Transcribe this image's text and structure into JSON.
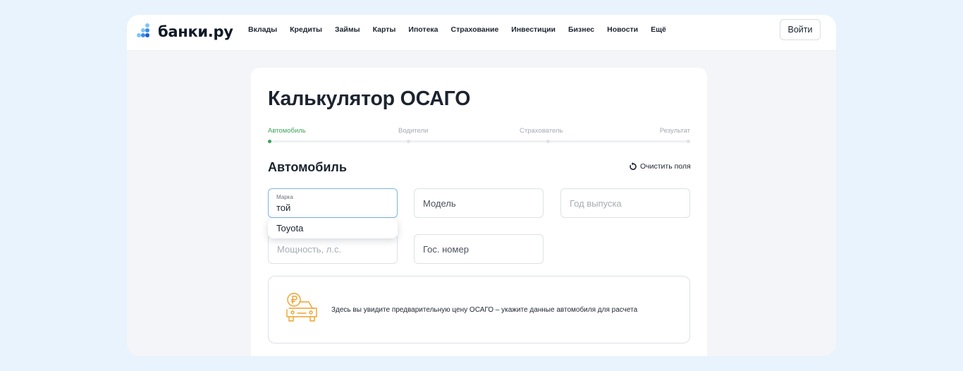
{
  "brand": {
    "name": "банки.ру",
    "dot_colors": [
      "#7ec6f5",
      "#3d8ef0",
      "#1b5fd1"
    ]
  },
  "nav": {
    "items": [
      "Вклады",
      "Кредиты",
      "Займы",
      "Карты",
      "Ипотека",
      "Страхование",
      "Инвестиции",
      "Бизнес",
      "Новости",
      "Ещё"
    ]
  },
  "header": {
    "login_label": "Войти"
  },
  "page": {
    "title": "Калькулятор ОСАГО"
  },
  "steps": {
    "items": [
      "Автомобиль",
      "Водители",
      "Страхователь",
      "Результат"
    ],
    "active_index": 0,
    "active_color": "#3aa657"
  },
  "section": {
    "title": "Автомобиль",
    "clear_label": "Очистить поля",
    "clear_icon": "refresh-icon"
  },
  "form": {
    "brand_field": {
      "label": "Марка",
      "value": "той"
    },
    "model_field": {
      "placeholder": "Модель"
    },
    "year_field": {
      "placeholder": "Год выпуска"
    },
    "power_field": {
      "placeholder": "Мощность, л.с."
    },
    "plate_field": {
      "placeholder": "Гос. номер"
    },
    "suggestions": [
      "Toyota"
    ]
  },
  "info": {
    "icon": "car-ruble-icon",
    "text": "Здесь вы увидите предварительную цену ОСАГО – укажите данные автомобиля для расчета",
    "icon_color": "#f0a12b"
  }
}
